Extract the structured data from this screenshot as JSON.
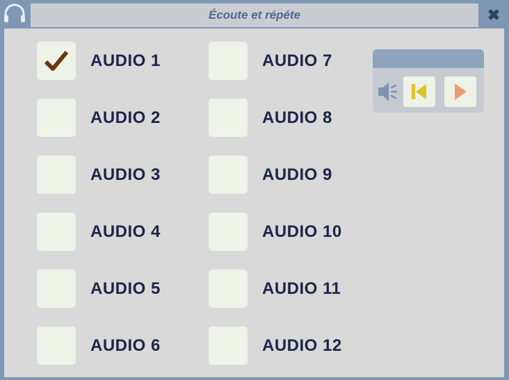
{
  "window": {
    "title": "Écoute et répéte",
    "close_glyph": "✖",
    "icon": "headphones-icon"
  },
  "audio_items_left": [
    {
      "label": "AUDIO 1",
      "checked": true
    },
    {
      "label": "AUDIO 2",
      "checked": false
    },
    {
      "label": "AUDIO 3",
      "checked": false
    },
    {
      "label": "AUDIO 4",
      "checked": false
    },
    {
      "label": "AUDIO 5",
      "checked": false
    },
    {
      "label": "AUDIO 6",
      "checked": false
    }
  ],
  "audio_items_right": [
    {
      "label": "AUDIO 7",
      "checked": false
    },
    {
      "label": "AUDIO 8",
      "checked": false
    },
    {
      "label": "AUDIO 9",
      "checked": false
    },
    {
      "label": "AUDIO 10",
      "checked": false
    },
    {
      "label": "AUDIO 11",
      "checked": false
    },
    {
      "label": "AUDIO 12",
      "checked": false
    }
  ],
  "player": {
    "icons": [
      "speaker-icon",
      "skip-back-icon",
      "play-icon"
    ]
  },
  "colors": {
    "frame": "#7e97b4",
    "content_bg": "#d9d9d9",
    "label_text": "#1c2548",
    "checkmark": "#6b3510",
    "skip_back": "#e0c12b",
    "play": "#ef9c76"
  }
}
